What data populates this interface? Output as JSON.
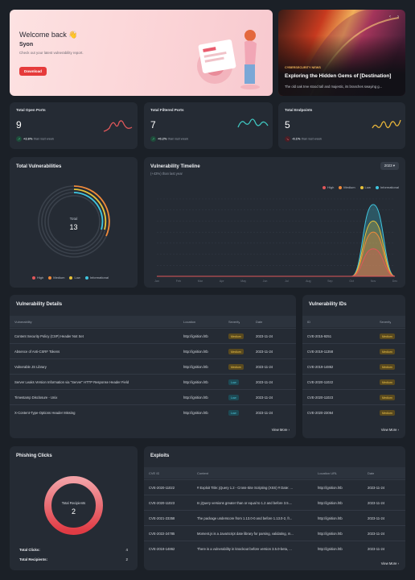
{
  "welcome": {
    "greeting": "Welcome back 👋",
    "name": "Syon",
    "subtitle": "Check out your latest vulnerability report.",
    "download_label": "Download"
  },
  "news": {
    "tag": "CYBERSECURITY NEWS",
    "title": "Exploring the Hidden Gems of [Destination]",
    "excerpt": "The old oak tree stood tall and majestic, its branches swaying g...",
    "nav_prev": "‹",
    "nav_next": "›"
  },
  "stats": [
    {
      "label": "Total Open Ports",
      "value": "9",
      "delta": "+2.6%",
      "delta_text": "than last week",
      "color": "#e0575a"
    },
    {
      "label": "Total Filtered Ports",
      "value": "7",
      "delta": "+0.2%",
      "delta_text": "than last week",
      "color": "#3fc6c0"
    },
    {
      "label": "Total Endpoints",
      "value": "5",
      "delta": "-0.1%",
      "delta_text": "than last week",
      "color": "#e6b43a"
    }
  ],
  "vulns": {
    "title": "Total Vulnerabilities",
    "center_label": "Total",
    "center_value": "13",
    "legend": [
      {
        "name": "High",
        "color": "#e0575a"
      },
      {
        "name": "Medium",
        "color": "#f08a3a"
      },
      {
        "name": "Low",
        "color": "#e6c23a"
      },
      {
        "name": "Informational",
        "color": "#3fc6e0"
      }
    ]
  },
  "timeline": {
    "title": "Vulnerability Timeline",
    "subtitle": "(+43%) than last year",
    "year": "2023",
    "legend": [
      {
        "name": "High",
        "color": "#e0575a"
      },
      {
        "name": "Medium",
        "color": "#f08a3a"
      },
      {
        "name": "Low",
        "color": "#e6c23a"
      },
      {
        "name": "Informational",
        "color": "#3fc6e0"
      }
    ]
  },
  "chart_data": {
    "type": "area",
    "title": "Vulnerability Timeline",
    "categories": [
      "Jan",
      "Feb",
      "Mar",
      "Apr",
      "May",
      "Jun",
      "Jul",
      "Aug",
      "Sep",
      "Oct",
      "Nov",
      "Dec"
    ],
    "series": [
      {
        "name": "Informational",
        "values": [
          0,
          0,
          0,
          0,
          0,
          0,
          0,
          0,
          0,
          0,
          13,
          0
        ]
      },
      {
        "name": "Low",
        "values": [
          0,
          0,
          0,
          0,
          0,
          0,
          0,
          0,
          0,
          0,
          10,
          0
        ]
      },
      {
        "name": "Medium",
        "values": [
          0,
          0,
          0,
          0,
          0,
          0,
          0,
          0,
          0,
          0,
          8,
          0
        ]
      },
      {
        "name": "High",
        "values": [
          0,
          0,
          0,
          0,
          0,
          0,
          0,
          0,
          0,
          0,
          5,
          0
        ]
      }
    ]
  },
  "details": {
    "title": "Vulnerability Details",
    "headers": [
      "Vulnerability",
      "Location",
      "Severity",
      "Date"
    ],
    "rows": [
      {
        "name": "Content Security Policy (CSP) Header Not Set",
        "loc": "http://ignition.htb",
        "sev": "Medium",
        "date": "2023-11-24"
      },
      {
        "name": "Absence of Anti-CSRF Tokens",
        "loc": "http://ignition.htb",
        "sev": "Medium",
        "date": "2023-11-24"
      },
      {
        "name": "Vulnerable JS Library",
        "loc": "http://ignition.htb",
        "sev": "Medium",
        "date": "2023-11-24"
      },
      {
        "name": "Server Leaks Version Information via \"Server\" HTTP Response Header Field",
        "loc": "http://ignition.htb",
        "sev": "Low",
        "date": "2023-11-24"
      },
      {
        "name": "Timestamp Disclosure - Unix",
        "loc": "http://ignition.htb",
        "sev": "Low",
        "date": "2023-11-24"
      },
      {
        "name": "X-Content-Type-Options Header Missing",
        "loc": "http://ignition.htb",
        "sev": "Low",
        "date": "2023-11-24"
      }
    ],
    "view_more": "View More ›"
  },
  "ids": {
    "title": "Vulnerability IDs",
    "headers": [
      "ID",
      "Severity"
    ],
    "rows": [
      {
        "id": "CVE-2015-9251",
        "sev": "Medium"
      },
      {
        "id": "CVE-2019-11358",
        "sev": "Medium"
      },
      {
        "id": "CVE-2019-14862",
        "sev": "Medium"
      },
      {
        "id": "CVE-2020-11022",
        "sev": "Medium"
      },
      {
        "id": "CVE-2020-11023",
        "sev": "Medium"
      },
      {
        "id": "CVE-2020-23064",
        "sev": "Medium"
      }
    ],
    "view_more": "View More ›"
  },
  "phishing": {
    "title": "Phishing Clicks",
    "center_label": "Total Recipients",
    "center_value": "2",
    "clicks_label": "Total Clicks:",
    "clicks_value": "4",
    "recipients_label": "Total Recipients:",
    "recipients_value": "2"
  },
  "exploits": {
    "title": "Exploits",
    "headers": [
      "CVE ID",
      "Content",
      "Location URL",
      "Date"
    ],
    "rows": [
      {
        "id": "CVE-2020-11022",
        "content": "# Exploit Title: jQuery 1.2 - Cross-Site Scripting (XSS) # Date: ...",
        "loc": "http://ignition.htb",
        "date": "2023-11-24"
      },
      {
        "id": "CVE-2020-11023",
        "content": "In jQuery versions greater than or equal to 1.2 and before 3.5....",
        "loc": "http://ignition.htb",
        "date": "2023-11-24"
      },
      {
        "id": "CVE-2021-23358",
        "content": "The package underscore from 1.13.0-0 and before 1.13.0-2, fr...",
        "loc": "http://ignition.htb",
        "date": "2023-11-24"
      },
      {
        "id": "CVE-2022-24785",
        "content": "Moment.js is a JavaScript date library for parsing, validating, m...",
        "loc": "http://ignition.htb",
        "date": "2023-11-24"
      },
      {
        "id": "CVE-2019-14862",
        "content": "There is a vulnerability in knockout before version 3.5.0-beta, ...",
        "loc": "http://ignition.htb",
        "date": "2023-11-24"
      }
    ],
    "view_more": "View More ›"
  }
}
